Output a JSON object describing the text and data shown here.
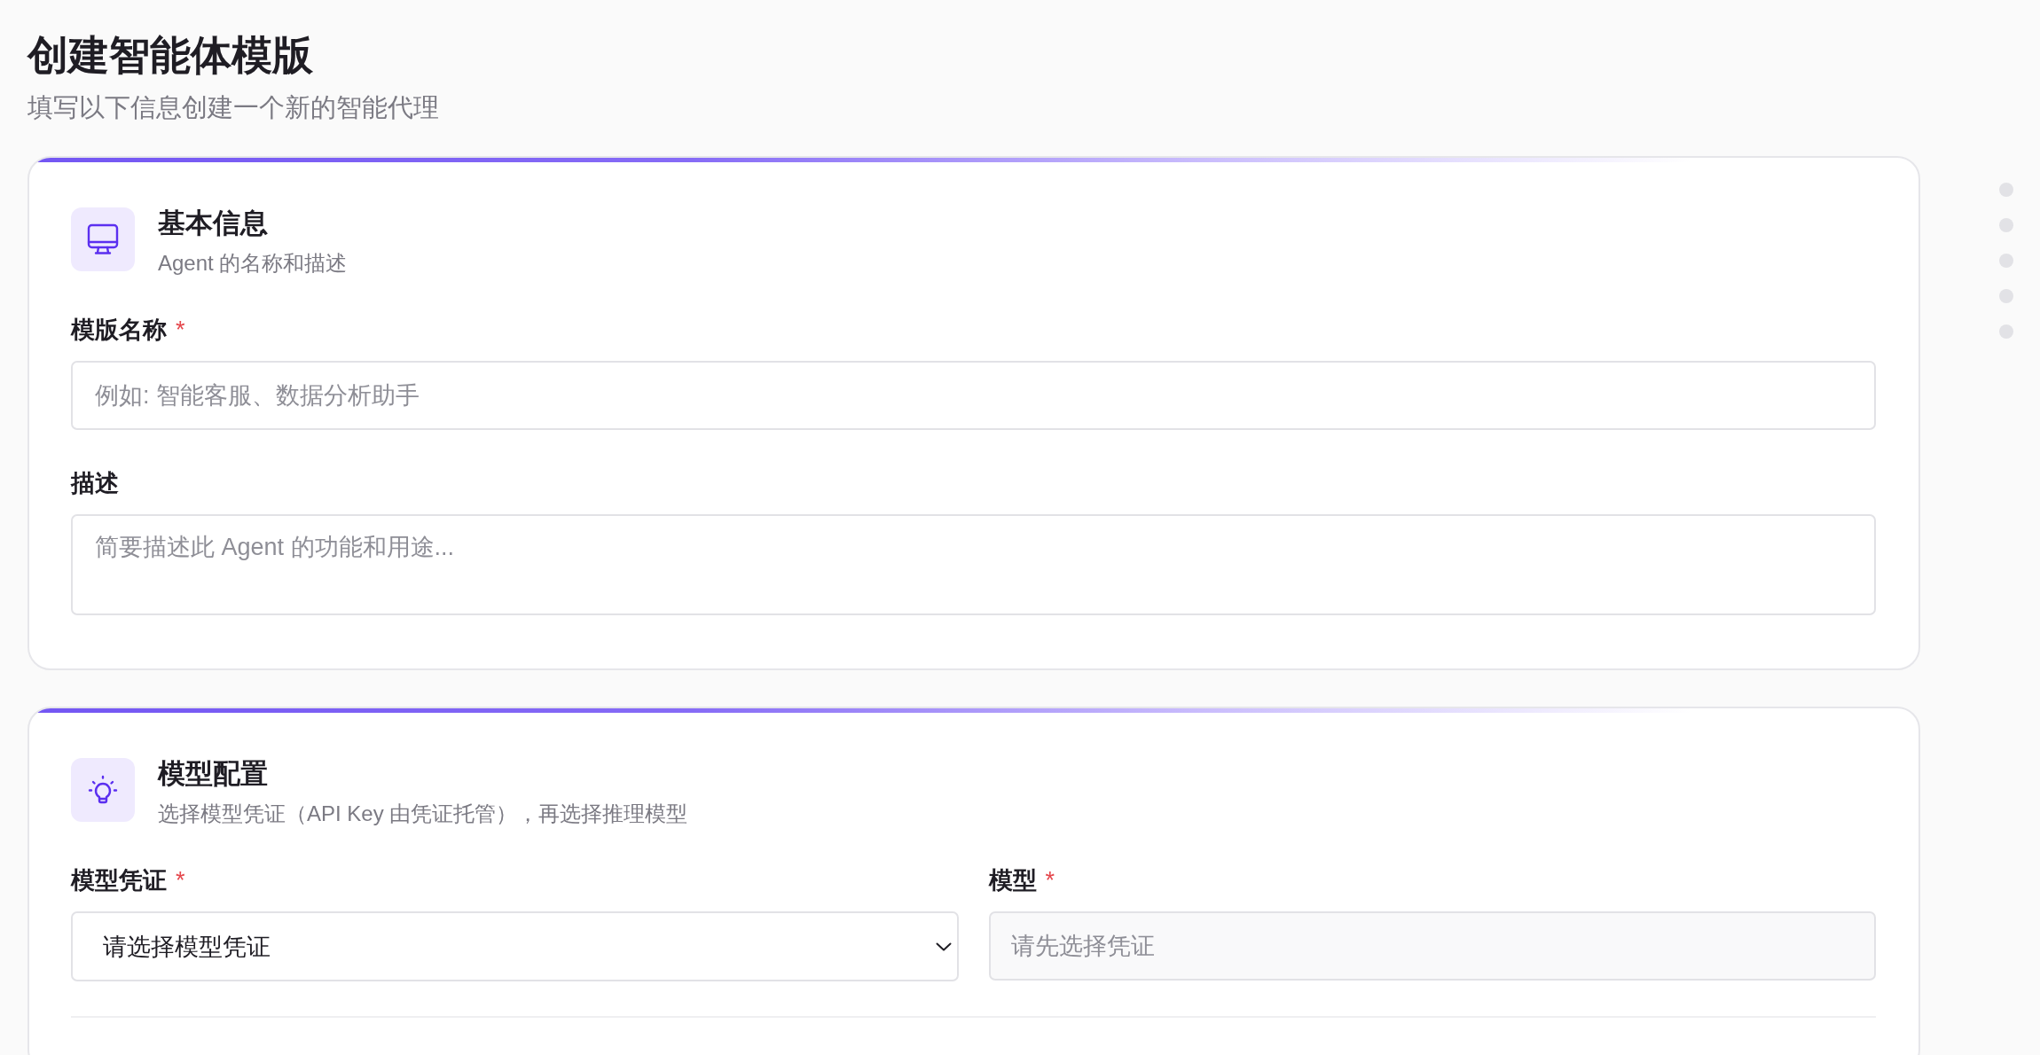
{
  "page": {
    "title": "创建智能体模版",
    "subtitle": "填写以下信息创建一个新的智能代理"
  },
  "sections": [
    {
      "title": "基本信息",
      "description": "Agent 的名称和描述",
      "rows": [
        [
          {
            "kind": "input",
            "label": "模版名称",
            "required_mark": "*",
            "placeholder": "例如: 智能客服、数据分析助手",
            "disabled": false
          }
        ],
        [
          {
            "kind": "textarea",
            "label": "描述",
            "placeholder": "简要描述此 Agent 的功能和用途...",
            "disabled": false
          }
        ]
      ]
    },
    {
      "title": "模型配置",
      "description": "选择模型凭证（API Key 由凭证托管），再选择推理模型",
      "rows": [
        [
          {
            "kind": "select",
            "label": "模型凭证",
            "required_mark": "*",
            "value": "请选择模型凭证",
            "disabled": false
          },
          {
            "kind": "input",
            "label": "模型",
            "required_mark": "*",
            "placeholder": "请先选择凭证",
            "disabled": true
          }
        ]
      ]
    }
  ],
  "section_nav": [
    {
      "selected": false
    },
    {
      "selected": false
    },
    {
      "selected": false
    },
    {
      "selected": false
    },
    {
      "selected": false
    }
  ]
}
